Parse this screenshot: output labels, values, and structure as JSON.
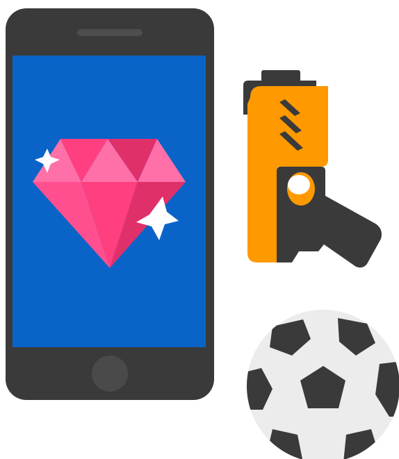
{
  "illustration": {
    "items": [
      "smartphone-icon",
      "gem-icon",
      "toy-gun-icon",
      "soccer-ball-icon"
    ],
    "colors": {
      "phone_body": "#3a3a3a",
      "phone_screen": "#0a64c8",
      "home_button": "#4a4a4a",
      "gem_light": "#ff6fa8",
      "gem_mid": "#ff3f7f",
      "gem_dark": "#e0306a",
      "sparkle": "#ffffff",
      "gun_orange": "#ff9900",
      "gun_dark": "#3a3a3a",
      "ball_white": "#ececec",
      "ball_black": "#3a3a3a"
    }
  }
}
